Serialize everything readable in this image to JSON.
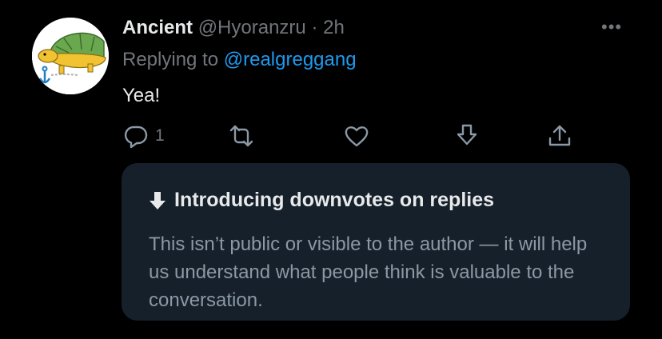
{
  "tweet": {
    "author_name": "Ancient",
    "author_handle": "@Hyoranzru",
    "separator": "·",
    "time": "2h",
    "more_label": "•••",
    "replying_prefix": "Replying to",
    "replying_to": "@realgreggang",
    "text": "Yea!"
  },
  "actions": {
    "reply_count": "1",
    "icons": [
      "reply-icon",
      "retweet-icon",
      "like-icon",
      "downvote-icon",
      "share-icon"
    ]
  },
  "notice": {
    "icon": "arrow-down-icon",
    "title": "Introducing downvotes on replies",
    "body": "This isn’t public or visible to the author — it will help us understand what people think is valuable to the conversation."
  },
  "colors": {
    "background": "#000000",
    "text_primary": "#e7e9ea",
    "text_secondary": "#71767b",
    "link": "#1d9bf0",
    "card_background": "#16202a",
    "card_text": "#8b98a5",
    "turtle_shell": "#6aa84f",
    "turtle_body": "#f1c232"
  }
}
